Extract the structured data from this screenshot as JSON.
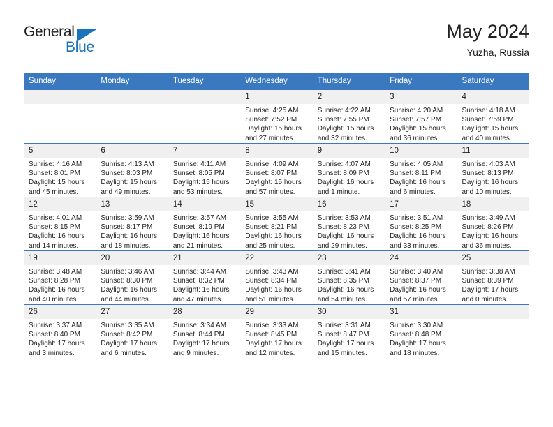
{
  "brand": {
    "name_top": "General",
    "name_bottom": "Blue",
    "triangle_icon": "blue-triangle-logo-mark"
  },
  "header": {
    "title": "May 2024",
    "location": "Yuzha, Russia"
  },
  "colors": {
    "header_blue": "#3a79bf",
    "brand_blue": "#1b73ba",
    "daynum_band": "#f0f0f0",
    "text": "#231f20"
  },
  "calendar": {
    "weekday_headers": [
      "Sunday",
      "Monday",
      "Tuesday",
      "Wednesday",
      "Thursday",
      "Friday",
      "Saturday"
    ],
    "labels": {
      "sunrise": "Sunrise:",
      "sunset": "Sunset:",
      "daylight": "Daylight:"
    },
    "weeks": [
      [
        {
          "day": "",
          "lines": []
        },
        {
          "day": "",
          "lines": []
        },
        {
          "day": "",
          "lines": []
        },
        {
          "day": "1",
          "lines": [
            "Sunrise: 4:25 AM",
            "Sunset: 7:52 PM",
            "Daylight: 15 hours",
            "and 27 minutes."
          ]
        },
        {
          "day": "2",
          "lines": [
            "Sunrise: 4:22 AM",
            "Sunset: 7:55 PM",
            "Daylight: 15 hours",
            "and 32 minutes."
          ]
        },
        {
          "day": "3",
          "lines": [
            "Sunrise: 4:20 AM",
            "Sunset: 7:57 PM",
            "Daylight: 15 hours",
            "and 36 minutes."
          ]
        },
        {
          "day": "4",
          "lines": [
            "Sunrise: 4:18 AM",
            "Sunset: 7:59 PM",
            "Daylight: 15 hours",
            "and 40 minutes."
          ]
        }
      ],
      [
        {
          "day": "5",
          "lines": [
            "Sunrise: 4:16 AM",
            "Sunset: 8:01 PM",
            "Daylight: 15 hours",
            "and 45 minutes."
          ]
        },
        {
          "day": "6",
          "lines": [
            "Sunrise: 4:13 AM",
            "Sunset: 8:03 PM",
            "Daylight: 15 hours",
            "and 49 minutes."
          ]
        },
        {
          "day": "7",
          "lines": [
            "Sunrise: 4:11 AM",
            "Sunset: 8:05 PM",
            "Daylight: 15 hours",
            "and 53 minutes."
          ]
        },
        {
          "day": "8",
          "lines": [
            "Sunrise: 4:09 AM",
            "Sunset: 8:07 PM",
            "Daylight: 15 hours",
            "and 57 minutes."
          ]
        },
        {
          "day": "9",
          "lines": [
            "Sunrise: 4:07 AM",
            "Sunset: 8:09 PM",
            "Daylight: 16 hours",
            "and 1 minute."
          ]
        },
        {
          "day": "10",
          "lines": [
            "Sunrise: 4:05 AM",
            "Sunset: 8:11 PM",
            "Daylight: 16 hours",
            "and 6 minutes."
          ]
        },
        {
          "day": "11",
          "lines": [
            "Sunrise: 4:03 AM",
            "Sunset: 8:13 PM",
            "Daylight: 16 hours",
            "and 10 minutes."
          ]
        }
      ],
      [
        {
          "day": "12",
          "lines": [
            "Sunrise: 4:01 AM",
            "Sunset: 8:15 PM",
            "Daylight: 16 hours",
            "and 14 minutes."
          ]
        },
        {
          "day": "13",
          "lines": [
            "Sunrise: 3:59 AM",
            "Sunset: 8:17 PM",
            "Daylight: 16 hours",
            "and 18 minutes."
          ]
        },
        {
          "day": "14",
          "lines": [
            "Sunrise: 3:57 AM",
            "Sunset: 8:19 PM",
            "Daylight: 16 hours",
            "and 21 minutes."
          ]
        },
        {
          "day": "15",
          "lines": [
            "Sunrise: 3:55 AM",
            "Sunset: 8:21 PM",
            "Daylight: 16 hours",
            "and 25 minutes."
          ]
        },
        {
          "day": "16",
          "lines": [
            "Sunrise: 3:53 AM",
            "Sunset: 8:23 PM",
            "Daylight: 16 hours",
            "and 29 minutes."
          ]
        },
        {
          "day": "17",
          "lines": [
            "Sunrise: 3:51 AM",
            "Sunset: 8:25 PM",
            "Daylight: 16 hours",
            "and 33 minutes."
          ]
        },
        {
          "day": "18",
          "lines": [
            "Sunrise: 3:49 AM",
            "Sunset: 8:26 PM",
            "Daylight: 16 hours",
            "and 36 minutes."
          ]
        }
      ],
      [
        {
          "day": "19",
          "lines": [
            "Sunrise: 3:48 AM",
            "Sunset: 8:28 PM",
            "Daylight: 16 hours",
            "and 40 minutes."
          ]
        },
        {
          "day": "20",
          "lines": [
            "Sunrise: 3:46 AM",
            "Sunset: 8:30 PM",
            "Daylight: 16 hours",
            "and 44 minutes."
          ]
        },
        {
          "day": "21",
          "lines": [
            "Sunrise: 3:44 AM",
            "Sunset: 8:32 PM",
            "Daylight: 16 hours",
            "and 47 minutes."
          ]
        },
        {
          "day": "22",
          "lines": [
            "Sunrise: 3:43 AM",
            "Sunset: 8:34 PM",
            "Daylight: 16 hours",
            "and 51 minutes."
          ]
        },
        {
          "day": "23",
          "lines": [
            "Sunrise: 3:41 AM",
            "Sunset: 8:35 PM",
            "Daylight: 16 hours",
            "and 54 minutes."
          ]
        },
        {
          "day": "24",
          "lines": [
            "Sunrise: 3:40 AM",
            "Sunset: 8:37 PM",
            "Daylight: 16 hours",
            "and 57 minutes."
          ]
        },
        {
          "day": "25",
          "lines": [
            "Sunrise: 3:38 AM",
            "Sunset: 8:39 PM",
            "Daylight: 17 hours",
            "and 0 minutes."
          ]
        }
      ],
      [
        {
          "day": "26",
          "lines": [
            "Sunrise: 3:37 AM",
            "Sunset: 8:40 PM",
            "Daylight: 17 hours",
            "and 3 minutes."
          ]
        },
        {
          "day": "27",
          "lines": [
            "Sunrise: 3:35 AM",
            "Sunset: 8:42 PM",
            "Daylight: 17 hours",
            "and 6 minutes."
          ]
        },
        {
          "day": "28",
          "lines": [
            "Sunrise: 3:34 AM",
            "Sunset: 8:44 PM",
            "Daylight: 17 hours",
            "and 9 minutes."
          ]
        },
        {
          "day": "29",
          "lines": [
            "Sunrise: 3:33 AM",
            "Sunset: 8:45 PM",
            "Daylight: 17 hours",
            "and 12 minutes."
          ]
        },
        {
          "day": "30",
          "lines": [
            "Sunrise: 3:31 AM",
            "Sunset: 8:47 PM",
            "Daylight: 17 hours",
            "and 15 minutes."
          ]
        },
        {
          "day": "31",
          "lines": [
            "Sunrise: 3:30 AM",
            "Sunset: 8:48 PM",
            "Daylight: 17 hours",
            "and 18 minutes."
          ]
        },
        {
          "day": "",
          "lines": []
        }
      ]
    ]
  }
}
